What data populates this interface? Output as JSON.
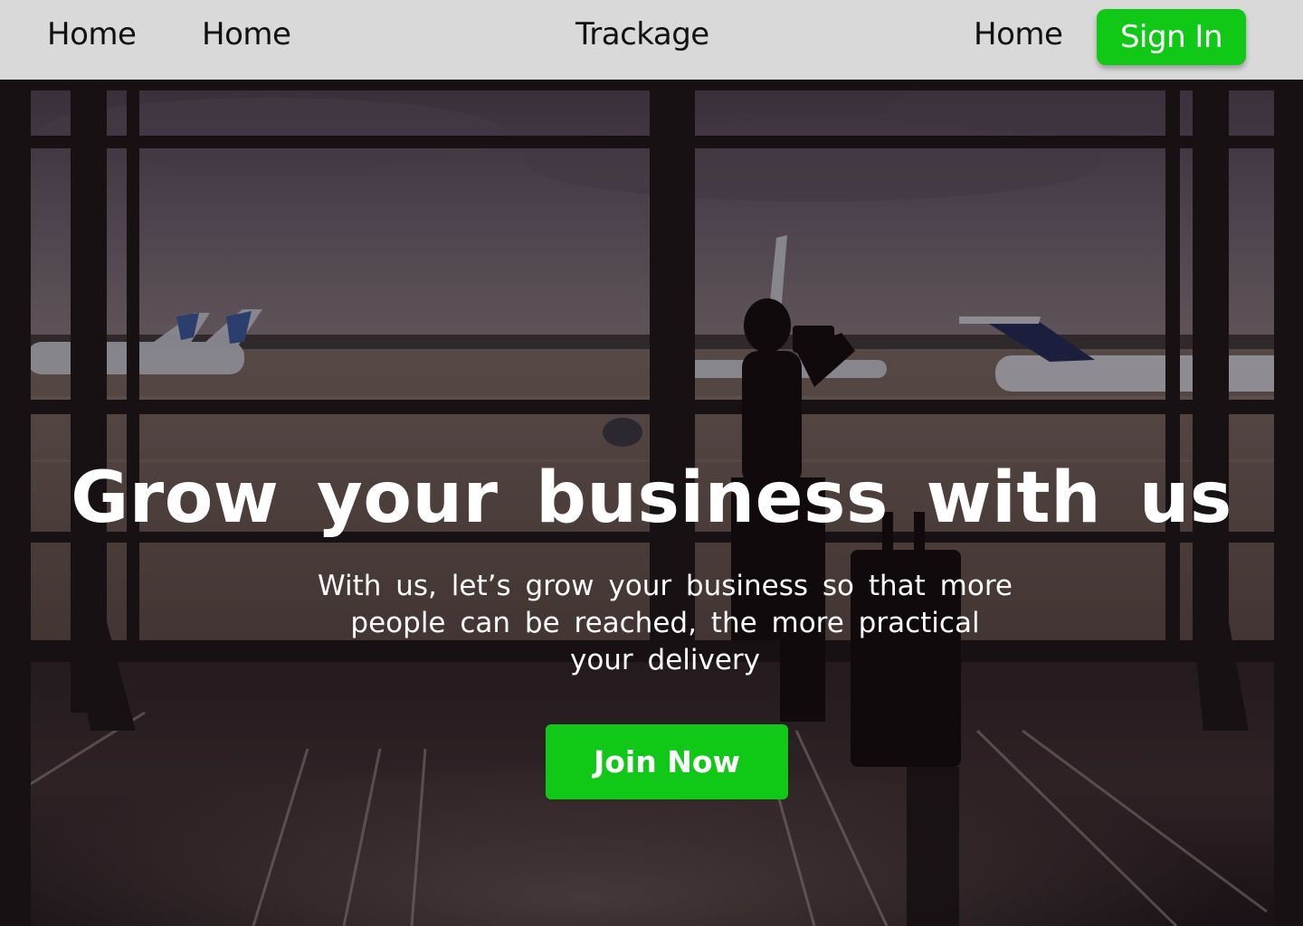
{
  "nav": {
    "links": [
      "Home",
      "Home"
    ],
    "brand": "Trackage",
    "right_link": "Home",
    "signin_label": "Sign In"
  },
  "hero": {
    "title": "Grow your business with us",
    "subtitle": "With us, let’s grow your business so that more people can be reached, the more practical your delivery",
    "cta_label": "Join Now"
  },
  "colors": {
    "nav_bg": "#d9d9d9",
    "accent_green": "#0fc916",
    "nav_text": "#111111",
    "hero_text": "#ffffff"
  }
}
